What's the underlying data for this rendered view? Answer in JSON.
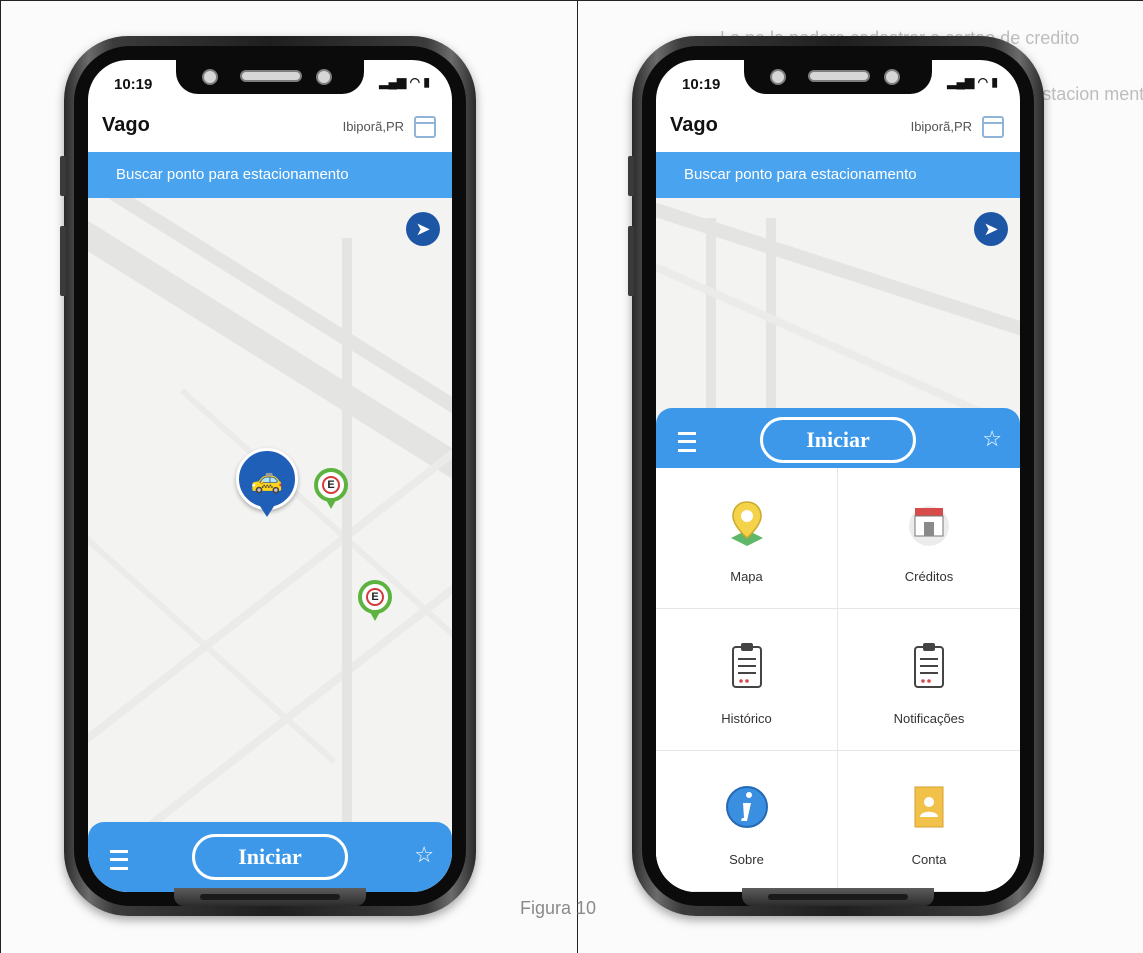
{
  "background_text": {
    "line1": "Lo    ne   la  podera cadastrar o cartao de credito",
    "line2": "de s  e  s gerenciar o dito    ponto de estacion  mento",
    "caption": "Figura 10"
  },
  "phone_left": {
    "status_time": "10:19",
    "status_icons": "▂▄▆ ◠ ▮",
    "app_title": "Vago",
    "city": "Ibiporã,PR",
    "search_label": "Buscar ponto para estacionamento",
    "car_icon": "car-icon",
    "parking_marker_label": "E",
    "start_label": "Iniciar"
  },
  "phone_right": {
    "status_time": "10:19",
    "status_icons": "▂▄▆ ◠ ▮",
    "app_title": "Vago",
    "city": "Ibiporã,PR",
    "search_label": "Buscar ponto para estacionamento",
    "start_label": "Iniciar",
    "menu_items": [
      {
        "label": "Mapa",
        "icon": "map-pin-icon"
      },
      {
        "label": "Créditos",
        "icon": "store-icon"
      },
      {
        "label": "Histórico",
        "icon": "clipboard-icon"
      },
      {
        "label": "Notificações",
        "icon": "clipboard-icon"
      },
      {
        "label": "Sobre",
        "icon": "info-icon"
      },
      {
        "label": "Conta",
        "icon": "account-card-icon"
      }
    ]
  },
  "colors": {
    "accent_blue": "#3d98ea",
    "search_blue": "#4aa3ee",
    "pin_blue": "#1f5fb7",
    "parking_green": "#5db33f"
  }
}
